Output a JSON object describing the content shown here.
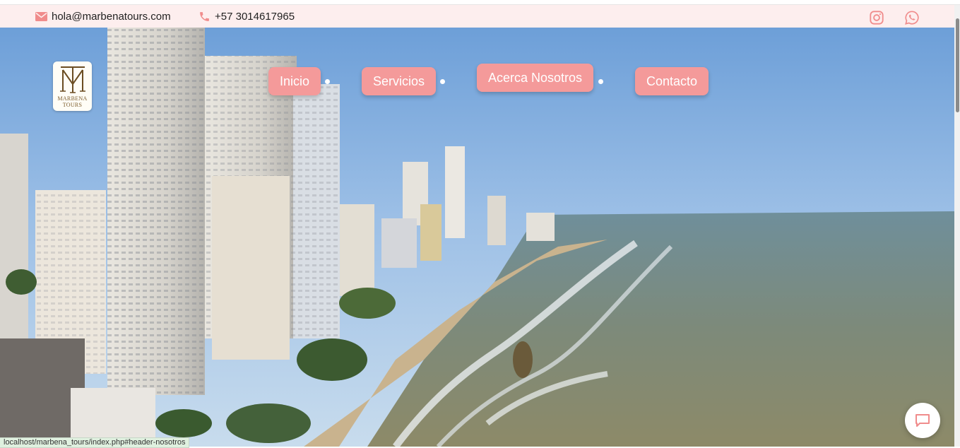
{
  "topbar": {
    "email": "hola@marbenatours.com",
    "phone": "+57 3014617965",
    "icons": {
      "email": "envelope-icon",
      "phone": "phone-icon",
      "instagram": "instagram-icon",
      "whatsapp": "whatsapp-icon"
    }
  },
  "logo": {
    "monogram": "MT",
    "line1": "MARBENA",
    "line2": "TOURS"
  },
  "nav": [
    {
      "label": "Inicio"
    },
    {
      "label": "Servicios"
    },
    {
      "label": "Acerca Nosotros"
    },
    {
      "label": "Contacto"
    }
  ],
  "status_bar": {
    "url": "localhost/marbena_tours/index.php#header-nosotros"
  },
  "chat": {
    "icon": "chat-bubble-icon"
  },
  "colors": {
    "accent": "#f49a9a",
    "topbar_bg": "#fdeeee",
    "icon_pink": "#f08c8c"
  }
}
